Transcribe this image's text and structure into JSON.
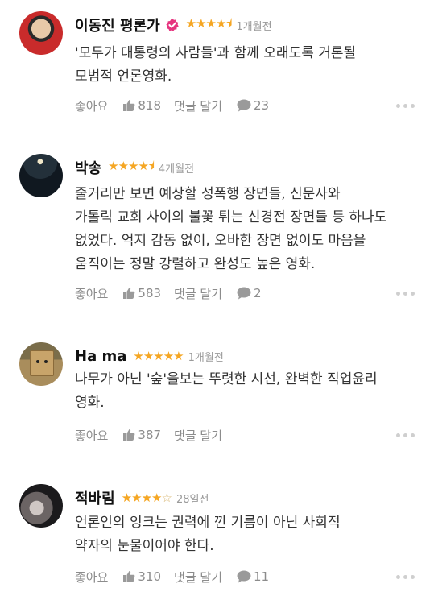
{
  "actions": {
    "like_label": "좋아요",
    "reply_label": "댓글 달기"
  },
  "colors": {
    "star": "#f5a623",
    "verified": "#e6357f"
  },
  "reviews": [
    {
      "author": "이동진 평론가",
      "verified": true,
      "rating": 4.5,
      "stars": "★★★★⯨",
      "ago": "1개월전",
      "text_lines": [
        "'모두가 대통령의 사람들'과 함께 오래도록 거론될",
        "모범적 언론영화."
      ],
      "likes": "818",
      "comments": "23"
    },
    {
      "author": "박송",
      "verified": false,
      "rating": 4.5,
      "stars": "★★★★⯨",
      "ago": "4개월전",
      "text_lines": [
        "줄거리만 보면 예상할 성폭행 장면들, 신문사와",
        "가톨릭 교회 사이의 불꽃 튀는 신경전 장면들 등 하나도",
        "없었다. 억지 감동 없이, 오바한 장면 없이도 마음을",
        "움직이는 정말 강렬하고 완성도 높은 영화."
      ],
      "likes": "583",
      "comments": "2"
    },
    {
      "author": "Ha ma",
      "verified": false,
      "rating": 5,
      "stars": "★★★★★",
      "ago": "1개월전",
      "text_lines": [
        "나무가 아닌 '숲'을보는 뚜렷한 시선, 완벽한 직업윤리",
        "영화."
      ],
      "likes": "387",
      "comments": ""
    },
    {
      "author": "적바림",
      "verified": false,
      "rating": 4,
      "stars": "★★★★",
      "stars_empty": "☆",
      "ago": "28일전",
      "text_lines": [
        "언론인의 잉크는 권력에 낀 기름이 아닌 사회적",
        "약자의 눈물이어야 한다."
      ],
      "likes": "310",
      "comments": "11"
    }
  ]
}
